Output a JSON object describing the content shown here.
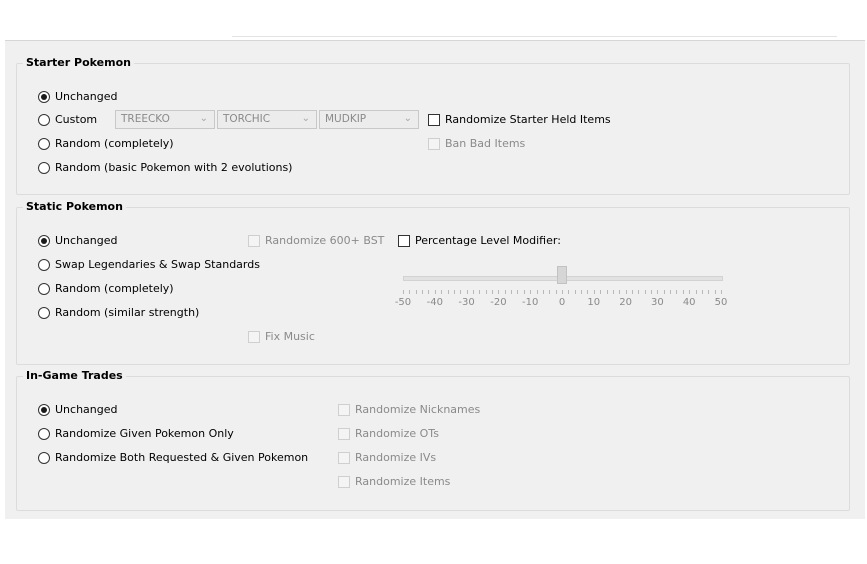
{
  "starter": {
    "title": "Starter Pokemon",
    "options": [
      "Unchanged",
      "Custom",
      "Random (completely)",
      "Random (basic Pokemon with 2 evolutions)"
    ],
    "selected": 0,
    "combos": [
      "TREECKO",
      "TORCHIC",
      "MUDKIP"
    ],
    "randomize_held_items": "Randomize Starter Held Items",
    "ban_bad_items": "Ban Bad Items"
  },
  "static": {
    "title": "Static Pokemon",
    "options": [
      "Unchanged",
      "Swap Legendaries & Swap Standards",
      "Random (completely)",
      "Random (similar strength)"
    ],
    "selected": 0,
    "randomize_600_bst": "Randomize 600+ BST",
    "percentage_level_modifier": "Percentage Level Modifier:",
    "fix_music": "Fix Music",
    "slider_value": 0,
    "slider_labels": [
      "-50",
      "-40",
      "-30",
      "-20",
      "-10",
      "0",
      "10",
      "20",
      "30",
      "40",
      "50"
    ]
  },
  "trades": {
    "title": "In-Game Trades",
    "options": [
      "Unchanged",
      "Randomize Given Pokemon Only",
      "Randomize Both Requested & Given Pokemon"
    ],
    "selected": 0,
    "checkboxes": [
      "Randomize Nicknames",
      "Randomize OTs",
      "Randomize IVs",
      "Randomize Items"
    ]
  },
  "colors": {
    "panel_bg": "#f0f0f0",
    "disabled_text": "#8a8a8a"
  },
  "icons": {
    "combo_arrow": "chevron-down-icon",
    "radio": "radio-icon",
    "checkbox": "checkbox-icon"
  }
}
